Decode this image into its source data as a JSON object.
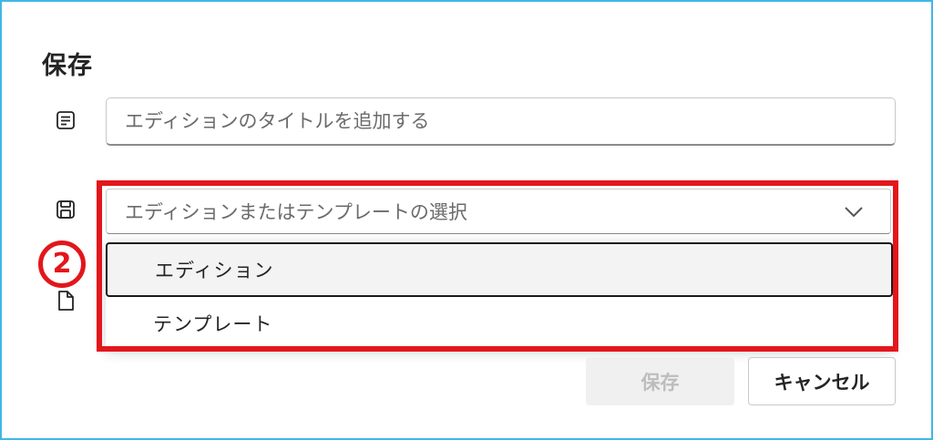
{
  "dialog": {
    "title": "保存"
  },
  "title_field": {
    "placeholder": "エディションのタイトルを追加する",
    "value": ""
  },
  "type_select": {
    "placeholder": "エディションまたはテンプレートの選択",
    "options": [
      {
        "label": "エディション",
        "focused": true
      },
      {
        "label": "テンプレート",
        "focused": false
      }
    ]
  },
  "annotation": {
    "step_number": "2",
    "color": "#e3161c"
  },
  "buttons": {
    "save_label": "保存",
    "cancel_label": "キャンセル"
  },
  "icons": {
    "title_field": "text-title-icon",
    "type_select": "save-floppy-icon",
    "extra_row": "document-icon",
    "select_chevron": "chevron-down-icon"
  }
}
